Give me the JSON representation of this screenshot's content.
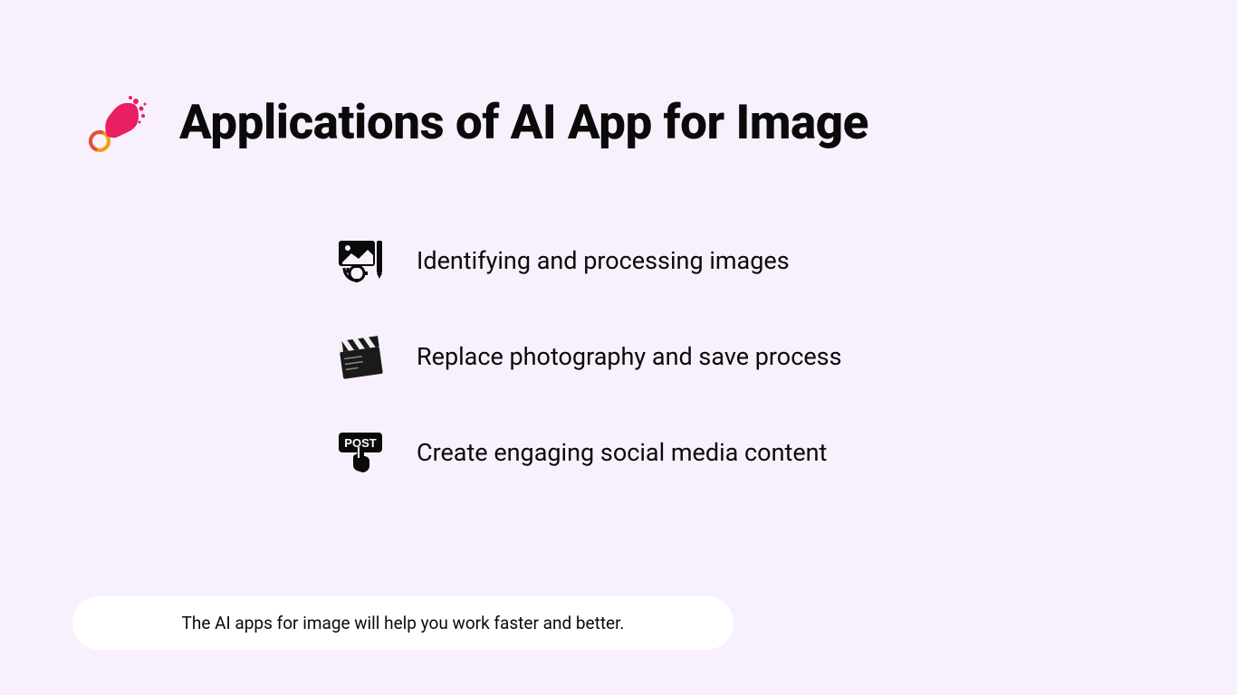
{
  "header": {
    "title": "Applications of AI App for Image"
  },
  "list": {
    "items": [
      {
        "label": "Identifying and processing images"
      },
      {
        "label": "Replace photography and save process"
      },
      {
        "label": "Create engaging social media content"
      }
    ]
  },
  "footer": {
    "text": "The AI apps for image will help you work faster and better."
  }
}
